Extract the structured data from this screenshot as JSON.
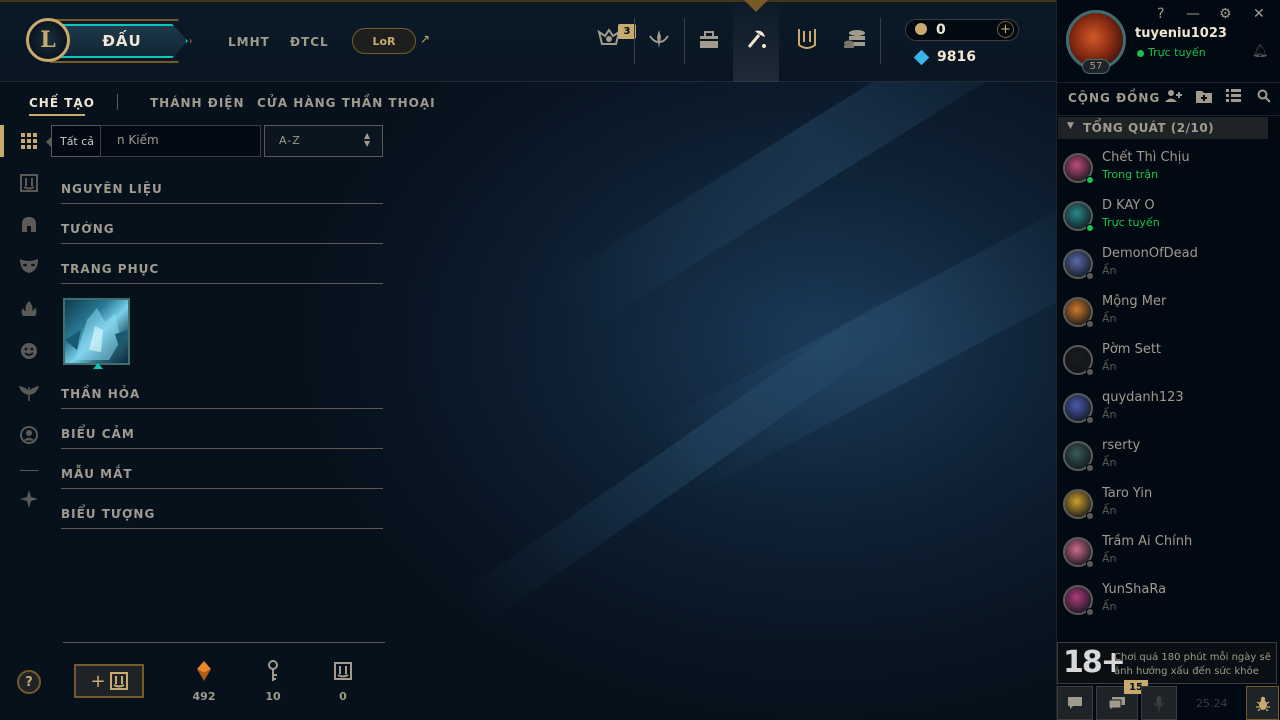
{
  "topbar": {
    "logo": "L",
    "play_label": "ĐẤU",
    "nav": [
      "LMHT",
      "ĐTCL"
    ],
    "lor_label": "LoR",
    "lor_external_icon": "↗",
    "missions_badge": "3",
    "rp": "0",
    "blue_essence": "9816"
  },
  "profile": {
    "username": "tuyeniu1023",
    "status": "Trực tuyến",
    "level": "57",
    "window_controls": [
      "?",
      "—",
      "⚙",
      "✕"
    ]
  },
  "collection": {
    "tabs": [
      "CHẾ TẠO",
      "THÁNH ĐIỆN",
      "CỬA HÀNG THẦN THOẠI"
    ],
    "tooltip": "Tất cả",
    "search_visible": "n Kiếm",
    "sort_value": "A-Z",
    "categories": [
      "NGUYÊN LIỆU",
      "TƯỚNG",
      "TRANG PHỤC",
      "THẦN HỎA",
      "BIỂU CẢM",
      "MẪU MẮT",
      "BIỂU TƯỢNG"
    ],
    "craft_button_label": "+",
    "resources": [
      {
        "icon": "orange-essence-icon",
        "value": "492",
        "color": "#e8862a"
      },
      {
        "icon": "key-icon",
        "value": "10",
        "color": "#a09b8c"
      },
      {
        "icon": "chest-icon",
        "value": "0",
        "color": "#a09b8c"
      }
    ],
    "help_label": "?"
  },
  "social": {
    "title": "CỘNG ĐỒNG",
    "group_label": "TỔNG QUÁT (2/10)",
    "friends": [
      {
        "name": "Chết Thì Chịu",
        "status": "Trong trận",
        "status_color": "#1dc14f",
        "dot": "#1dc14f",
        "avatar": "#c04a7a"
      },
      {
        "name": "D KAY O",
        "status": "Trực tuyến",
        "status_color": "#1dc14f",
        "dot": "#1dc14f",
        "avatar": "#2a8a8a"
      },
      {
        "name": "DemonOfDead",
        "status": "Ẩn",
        "status_color": "#5b5a56",
        "dot": "#5b5a56",
        "avatar": "#5a6aa8"
      },
      {
        "name": "Mộng Mer",
        "status": "Ẩn",
        "status_color": "#5b5a56",
        "dot": "#5b5a56",
        "avatar": "#d07a2a"
      },
      {
        "name": "Pờm Sett",
        "status": "Ẩn",
        "status_color": "#5b5a56",
        "dot": "#5b5a56",
        "avatar": "#1a1a1a"
      },
      {
        "name": "quydanh123",
        "status": "Ẩn",
        "status_color": "#5b5a56",
        "dot": "#5b5a56",
        "avatar": "#4a5ab0"
      },
      {
        "name": "rserty",
        "status": "Ẩn",
        "status_color": "#5b5a56",
        "dot": "#5b5a56",
        "avatar": "#3a5a58"
      },
      {
        "name": "Taro Yin",
        "status": "Ẩn",
        "status_color": "#5b5a56",
        "dot": "#5b5a56",
        "avatar": "#d0a02a"
      },
      {
        "name": "Trầm Ai Chính",
        "status": "Ẩn",
        "status_color": "#5b5a56",
        "dot": "#5b5a56",
        "avatar": "#d06a8a"
      },
      {
        "name": "YunShaRa",
        "status": "Ẩn",
        "status_color": "#5b5a56",
        "dot": "#5b5a56",
        "avatar": "#b03a7a"
      }
    ],
    "warning_age": "18+",
    "warning_text": "Chơi quá 180 phút mỗi ngày sẽ ảnh hưởng xấu đến sức khỏe",
    "chat_badge": "15",
    "version": "25.24"
  },
  "colors": {
    "gold": "#c8aa6e",
    "teal": "#0ac8b9",
    "online": "#1dc14f",
    "background": "#010a13"
  }
}
